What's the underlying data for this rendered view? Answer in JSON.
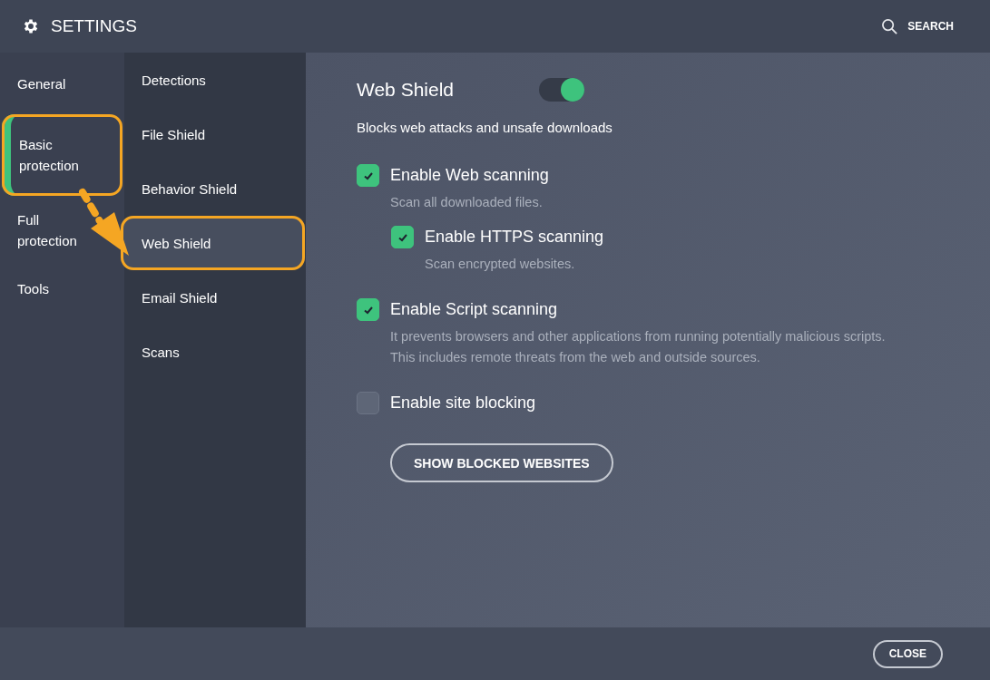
{
  "header": {
    "title": "SETTINGS",
    "search": "SEARCH"
  },
  "categories": [
    {
      "label": "General",
      "selected": false,
      "highlighted": false
    },
    {
      "label": "Basic protection",
      "selected": true,
      "highlighted": true
    },
    {
      "label": "Full protection",
      "selected": false,
      "highlighted": false
    },
    {
      "label": "Tools",
      "selected": false,
      "highlighted": false
    }
  ],
  "subsections": [
    {
      "label": "Detections",
      "selected": false,
      "highlighted": false
    },
    {
      "label": "File Shield",
      "selected": false,
      "highlighted": false
    },
    {
      "label": "Behavior Shield",
      "selected": false,
      "highlighted": false
    },
    {
      "label": "Web Shield",
      "selected": true,
      "highlighted": true
    },
    {
      "label": "Email Shield",
      "selected": false,
      "highlighted": false
    },
    {
      "label": "Scans",
      "selected": false,
      "highlighted": false
    }
  ],
  "panel": {
    "title": "Web Shield",
    "on": true,
    "description": "Blocks web attacks and unsafe downloads",
    "options": [
      {
        "label": "Enable Web scanning",
        "checked": true,
        "description": "Scan all downloaded files.",
        "children": [
          {
            "label": "Enable HTTPS scanning",
            "checked": true,
            "description": "Scan encrypted websites."
          }
        ]
      },
      {
        "label": "Enable Script scanning",
        "checked": true,
        "description": "It prevents browsers and other applications from running potentially malicious scripts. This includes remote threats from the web and outside sources."
      },
      {
        "label": "Enable site blocking",
        "checked": false
      }
    ],
    "button": "SHOW BLOCKED WEBSITES"
  },
  "footer": {
    "close": "CLOSE"
  }
}
